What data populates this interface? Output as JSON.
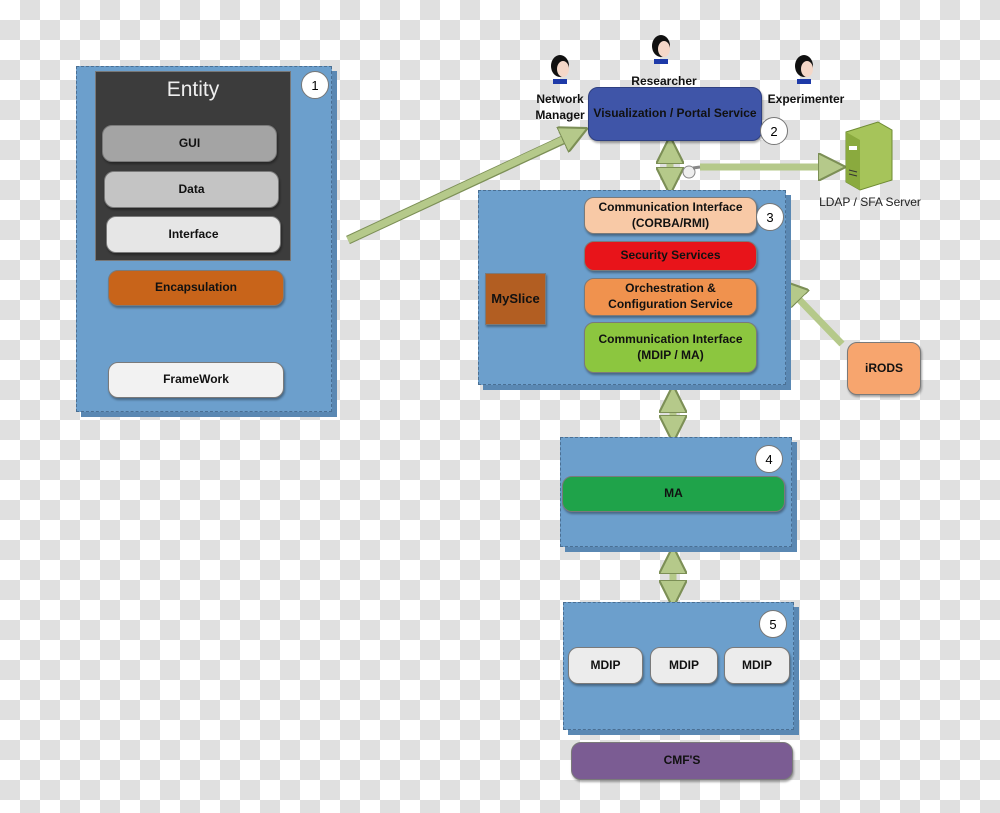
{
  "entity": {
    "title": "Entity",
    "layers": [
      "GUI",
      "Data",
      "Interface"
    ],
    "encapsulation": "Encapsulation",
    "framework": "FrameWork",
    "number": "1"
  },
  "portal": {
    "label": "Visualization / Portal Service",
    "number": "2"
  },
  "users": {
    "network_manager": "Network\nManager",
    "researcher": "Researcher",
    "experimenter": "Experimenter"
  },
  "ldap": {
    "label": "LDAP / SFA Server"
  },
  "core": {
    "number": "3",
    "comm_corba": "Communication Interface\n(CORBA/RMI)",
    "security": "Security Services",
    "orchestration": "Orchestration &\nConfiguration Service",
    "comm_mdip": "Communication Interface\n(MDIP / MA)",
    "myslice": "MySlice"
  },
  "irods": {
    "label": "iRODS"
  },
  "ma": {
    "label": "MA",
    "number": "4"
  },
  "mdip": {
    "number": "5",
    "items": [
      "MDIP",
      "MDIP",
      "MDIP"
    ]
  },
  "cmf": {
    "label": "CMF'S"
  },
  "colors": {
    "panel": "#6c9fcc",
    "portal": "#3f55a8",
    "security": "#e8141a",
    "orchestration": "#f0924e",
    "comm_corba": "#f8c9a6",
    "comm_mdip": "#8cc63f",
    "myslice": "#b25e22",
    "irods": "#f7a56e",
    "ma": "#1fa34a",
    "cmf": "#7b5c93",
    "encapsulation": "#c8641a",
    "arrow": "#b5c98a"
  }
}
